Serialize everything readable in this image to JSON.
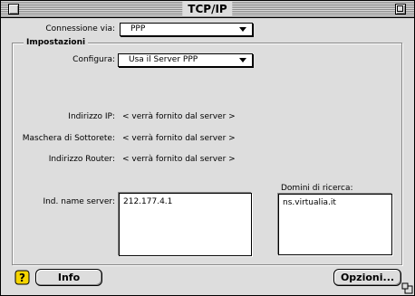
{
  "window": {
    "title": "TCP/IP"
  },
  "connection": {
    "label": "Connessione via:",
    "value": "PPP"
  },
  "settings": {
    "group_title": "Impostazioni",
    "configure_label": "Configura:",
    "configure_value": "Usa il Server PPP",
    "ip_label": "Indirizzo IP:",
    "ip_value": "< verrà fornito dal server >",
    "subnet_label": "Maschera di Sottorete:",
    "subnet_value": "< verrà fornito dal server >",
    "router_label": "Indirizzo Router:",
    "router_value": "< verrà fornito dal server >",
    "name_server_label": "Ind. name server:",
    "name_server_value": "212.177.4.1",
    "search_domains_label": "Domini di ricerca:",
    "search_domains_value": "ns.virtualia.it"
  },
  "buttons": {
    "info": "Info",
    "options": "Opzioni..."
  },
  "icons": {
    "help": "help-question-icon",
    "close": "close-box-icon",
    "zoom": "zoom-box-icon",
    "resize": "resize-grip-icon"
  }
}
